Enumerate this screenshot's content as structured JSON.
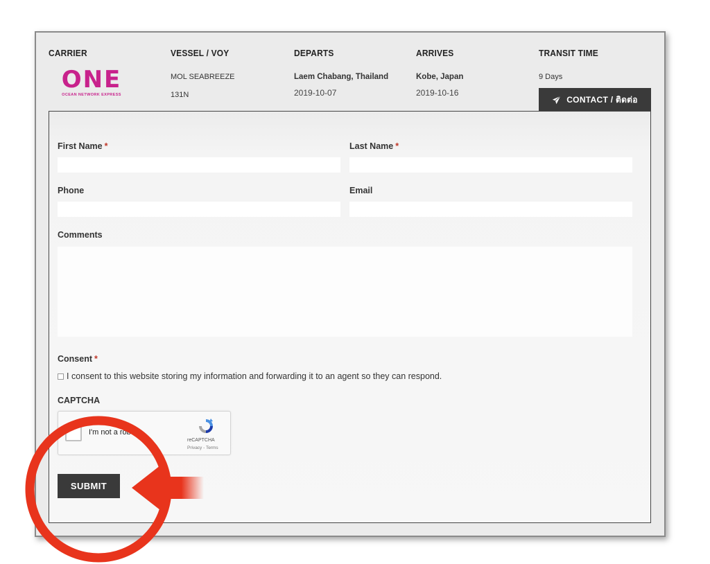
{
  "header": {
    "carrier_label": "CARRIER",
    "vessel_label": "VESSEL / VOY",
    "departs_label": "DEPARTS",
    "arrives_label": "ARRIVES",
    "transit_label": "TRANSIT TIME",
    "vessel_name": "MOL SEABREEZE",
    "voyage": "131N",
    "departs_port": "Laem Chabang, Thailand",
    "departs_date": "2019-10-07",
    "arrives_port": "Kobe, Japan",
    "arrives_date": "2019-10-16",
    "transit_time": "9 Days"
  },
  "logo": {
    "text": "ONE",
    "subtext": "OCEAN NETWORK EXPRESS",
    "color": "#c8228c"
  },
  "contact_tab": {
    "label": "CONTACT / ติดต่อ",
    "icon": "paper-plane-icon"
  },
  "form": {
    "first_name_label": "First Name",
    "last_name_label": "Last Name",
    "phone_label": "Phone",
    "email_label": "Email",
    "comments_label": "Comments",
    "consent_label": "Consent",
    "consent_text": "I consent to this website storing my information and forwarding it to an agent so they can respond.",
    "captcha_label": "CAPTCHA",
    "required_mark": "*",
    "submit_label": "SUBMIT"
  },
  "captcha": {
    "text": "I'm not a robot",
    "brand": "reCAPTCHA",
    "links": "Privacy - Terms"
  },
  "colors": {
    "accent_dark": "#3a3a3a",
    "annotation_red": "#e8341c",
    "required": "#c0392b"
  }
}
